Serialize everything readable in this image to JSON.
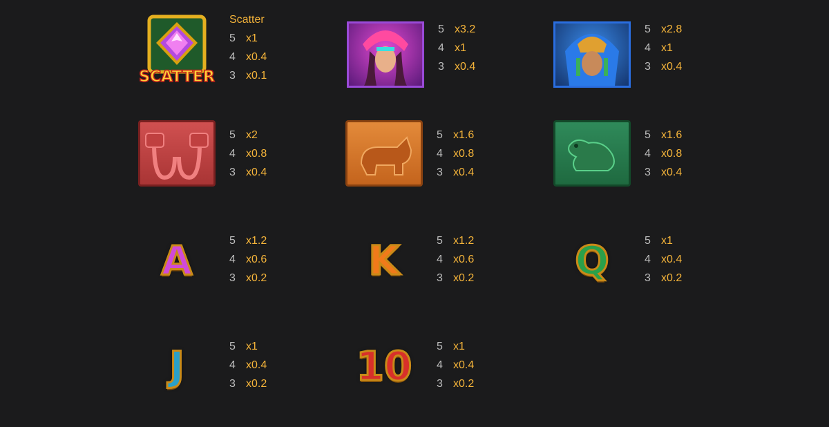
{
  "symbols": [
    {
      "name": "scatter",
      "title": "Scatter",
      "pays": [
        {
          "count": "5",
          "mult": "x1"
        },
        {
          "count": "4",
          "mult": "x0.4"
        },
        {
          "count": "3",
          "mult": "x0.1"
        }
      ],
      "icon_label": "SCATTER"
    },
    {
      "name": "warrior-woman",
      "pays": [
        {
          "count": "5",
          "mult": "x3.2"
        },
        {
          "count": "4",
          "mult": "x1"
        },
        {
          "count": "3",
          "mult": "x0.4"
        }
      ]
    },
    {
      "name": "jaguar-warrior",
      "pays": [
        {
          "count": "5",
          "mult": "x2.8"
        },
        {
          "count": "4",
          "mult": "x1"
        },
        {
          "count": "3",
          "mult": "x0.4"
        }
      ]
    },
    {
      "name": "serpent-tile",
      "pays": [
        {
          "count": "5",
          "mult": "x2"
        },
        {
          "count": "4",
          "mult": "x0.8"
        },
        {
          "count": "3",
          "mult": "x0.4"
        }
      ]
    },
    {
      "name": "jaguar-tile",
      "pays": [
        {
          "count": "5",
          "mult": "x1.6"
        },
        {
          "count": "4",
          "mult": "x0.8"
        },
        {
          "count": "3",
          "mult": "x0.4"
        }
      ]
    },
    {
      "name": "frog-tile",
      "pays": [
        {
          "count": "5",
          "mult": "x1.6"
        },
        {
          "count": "4",
          "mult": "x0.8"
        },
        {
          "count": "3",
          "mult": "x0.4"
        }
      ]
    },
    {
      "name": "letter-a",
      "glyph": "A",
      "pays": [
        {
          "count": "5",
          "mult": "x1.2"
        },
        {
          "count": "4",
          "mult": "x0.6"
        },
        {
          "count": "3",
          "mult": "x0.2"
        }
      ]
    },
    {
      "name": "letter-k",
      "glyph": "K",
      "pays": [
        {
          "count": "5",
          "mult": "x1.2"
        },
        {
          "count": "4",
          "mult": "x0.6"
        },
        {
          "count": "3",
          "mult": "x0.2"
        }
      ]
    },
    {
      "name": "letter-q",
      "glyph": "Q",
      "pays": [
        {
          "count": "5",
          "mult": "x1"
        },
        {
          "count": "4",
          "mult": "x0.4"
        },
        {
          "count": "3",
          "mult": "x0.2"
        }
      ]
    },
    {
      "name": "letter-j",
      "glyph": "J",
      "pays": [
        {
          "count": "5",
          "mult": "x1"
        },
        {
          "count": "4",
          "mult": "x0.4"
        },
        {
          "count": "3",
          "mult": "x0.2"
        }
      ]
    },
    {
      "name": "number-10",
      "glyph": "10",
      "pays": [
        {
          "count": "5",
          "mult": "x1"
        },
        {
          "count": "4",
          "mult": "x0.4"
        },
        {
          "count": "3",
          "mult": "x0.2"
        }
      ]
    }
  ],
  "colors": {
    "background": "#1b1b1c",
    "multiplier": "#f5b43a",
    "count": "#bdbdbd"
  }
}
